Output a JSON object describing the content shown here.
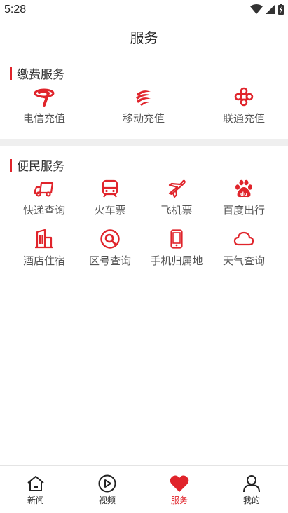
{
  "status_bar": {
    "time": "5:28"
  },
  "page_title": "服务",
  "payment": {
    "title": "缴费服务",
    "items": [
      {
        "label": "电信充值",
        "icon": "china-telecom-icon"
      },
      {
        "label": "移动充值",
        "icon": "china-mobile-icon"
      },
      {
        "label": "联通充值",
        "icon": "china-unicom-icon"
      }
    ]
  },
  "convenience": {
    "title": "便民服务",
    "items": [
      {
        "label": "快递查询",
        "icon": "truck-icon"
      },
      {
        "label": "火车票",
        "icon": "train-icon"
      },
      {
        "label": "飞机票",
        "icon": "airplane-icon"
      },
      {
        "label": "百度出行",
        "icon": "baidu-icon"
      },
      {
        "label": "酒店住宿",
        "icon": "building-icon"
      },
      {
        "label": "区号查询",
        "icon": "magnifier-icon"
      },
      {
        "label": "手机归属地",
        "icon": "phone-icon"
      },
      {
        "label": "天气查询",
        "icon": "cloud-icon"
      }
    ]
  },
  "bottom_nav": [
    {
      "label": "新闻",
      "icon": "home-icon"
    },
    {
      "label": "视频",
      "icon": "play-icon"
    },
    {
      "label": "服务",
      "icon": "heart-icon",
      "active": true
    },
    {
      "label": "我的",
      "icon": "person-icon"
    }
  ],
  "colors": {
    "accent": "#e0242b",
    "divider": "#efefef"
  }
}
